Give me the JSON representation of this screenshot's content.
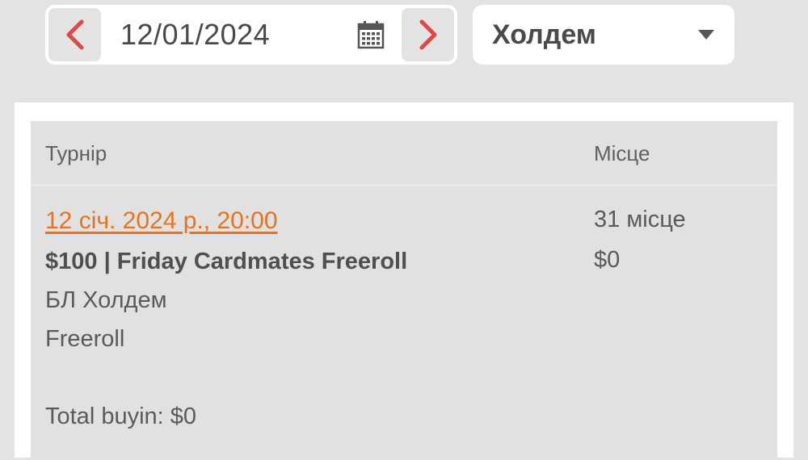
{
  "date_picker": {
    "date": "12/01/2024",
    "prev_icon": "chevron-left-icon",
    "next_icon": "chevron-right-icon",
    "calendar_icon": "calendar-icon"
  },
  "game_filter": {
    "selected": "Холдем",
    "icon": "caret-down-icon"
  },
  "table": {
    "headers": {
      "tournament": "Турнір",
      "place": "Місце"
    },
    "rows": [
      {
        "datetime": "12 січ. 2024 р., 20:00",
        "name": "$100 | Friday Cardmates Freeroll",
        "game": "БЛ Холдем",
        "buyin_type": "Freeroll",
        "total_buyin": "Total buyin: $0",
        "place": "31 місце",
        "prize": "$0"
      }
    ]
  },
  "colors": {
    "accent_arrow": "#e04848",
    "link": "#e8731f",
    "background": "#e3e3e3"
  }
}
